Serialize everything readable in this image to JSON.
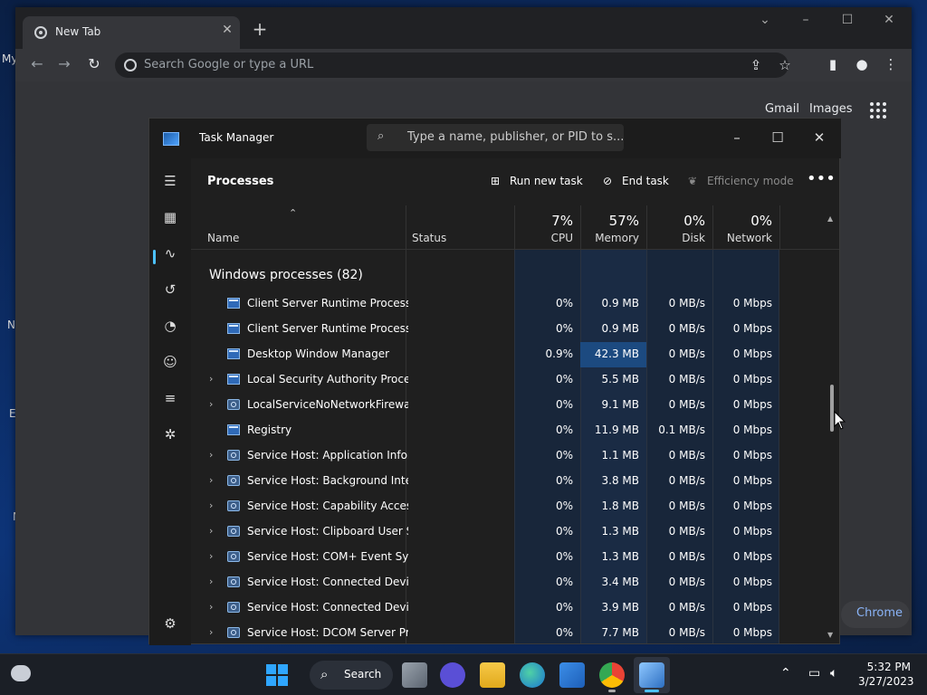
{
  "desktop": {
    "labels": [
      "My",
      "N",
      "E",
      "N"
    ]
  },
  "chrome": {
    "tab_title": "New Tab",
    "omnibox_placeholder": "Search Google or type a URL",
    "links": [
      "Gmail",
      "Images"
    ],
    "pill_label": "Chrome"
  },
  "tm": {
    "title": "Task Manager",
    "search_placeholder": "Type a name, publisher, or PID to s...",
    "page_title": "Processes",
    "actions": {
      "run": "Run new task",
      "end": "End task",
      "eff": "Efficiency mode"
    },
    "columns": {
      "name": "Name",
      "status": "Status",
      "cpu": {
        "pct": "7%",
        "label": "CPU"
      },
      "memory": {
        "pct": "57%",
        "label": "Memory"
      },
      "disk": {
        "pct": "0%",
        "label": "Disk"
      },
      "network": {
        "pct": "0%",
        "label": "Network"
      }
    },
    "group_label": "Windows processes (82)",
    "rows": [
      {
        "name": "Client Server Runtime Process",
        "cpu": "0%",
        "mem": "0.9 MB",
        "disk": "0 MB/s",
        "net": "0 Mbps",
        "expand": false,
        "icon": "window-icon"
      },
      {
        "name": "Client Server Runtime Process",
        "cpu": "0%",
        "mem": "0.9 MB",
        "disk": "0 MB/s",
        "net": "0 Mbps",
        "expand": false,
        "icon": "window-icon"
      },
      {
        "name": "Desktop Window Manager",
        "cpu": "0.9%",
        "mem": "42.3 MB",
        "disk": "0 MB/s",
        "net": "0 Mbps",
        "expand": false,
        "icon": "window-icon",
        "mem_hi": true
      },
      {
        "name": "Local Security Authority Proce...",
        "cpu": "0%",
        "mem": "5.5 MB",
        "disk": "0 MB/s",
        "net": "0 Mbps",
        "expand": true,
        "icon": "window-icon"
      },
      {
        "name": "LocalServiceNoNetworkFirewa...",
        "cpu": "0%",
        "mem": "9.1 MB",
        "disk": "0 MB/s",
        "net": "0 Mbps",
        "expand": true,
        "icon": "gear-icon"
      },
      {
        "name": "Registry",
        "cpu": "0%",
        "mem": "11.9 MB",
        "disk": "0.1 MB/s",
        "net": "0 Mbps",
        "expand": false,
        "icon": "window-icon"
      },
      {
        "name": "Service Host: Application Infor...",
        "cpu": "0%",
        "mem": "1.1 MB",
        "disk": "0 MB/s",
        "net": "0 Mbps",
        "expand": true,
        "icon": "gear-icon"
      },
      {
        "name": "Service Host: Background Inte...",
        "cpu": "0%",
        "mem": "3.8 MB",
        "disk": "0 MB/s",
        "net": "0 Mbps",
        "expand": true,
        "icon": "gear-icon"
      },
      {
        "name": "Service Host: Capability Acces...",
        "cpu": "0%",
        "mem": "1.8 MB",
        "disk": "0 MB/s",
        "net": "0 Mbps",
        "expand": true,
        "icon": "gear-icon"
      },
      {
        "name": "Service Host: Clipboard User S...",
        "cpu": "0%",
        "mem": "1.3 MB",
        "disk": "0 MB/s",
        "net": "0 Mbps",
        "expand": true,
        "icon": "gear-icon"
      },
      {
        "name": "Service Host: COM+ Event Sys...",
        "cpu": "0%",
        "mem": "1.3 MB",
        "disk": "0 MB/s",
        "net": "0 Mbps",
        "expand": true,
        "icon": "gear-icon"
      },
      {
        "name": "Service Host: Connected Devi...",
        "cpu": "0%",
        "mem": "3.4 MB",
        "disk": "0 MB/s",
        "net": "0 Mbps",
        "expand": true,
        "icon": "gear-icon"
      },
      {
        "name": "Service Host: Connected Devi...",
        "cpu": "0%",
        "mem": "3.9 MB",
        "disk": "0 MB/s",
        "net": "0 Mbps",
        "expand": true,
        "icon": "gear-icon"
      },
      {
        "name": "Service Host: DCOM Server Pr...",
        "cpu": "0%",
        "mem": "7.7 MB",
        "disk": "0 MB/s",
        "net": "0 Mbps",
        "expand": true,
        "icon": "gear-icon"
      }
    ]
  },
  "taskbar": {
    "search_label": "Search",
    "time": "5:32 PM",
    "date": "3/27/2023"
  },
  "colors": {
    "accent": "#4cc2ff",
    "col_bg": "#1a2a40",
    "mem_hi": "#1c4a80"
  }
}
